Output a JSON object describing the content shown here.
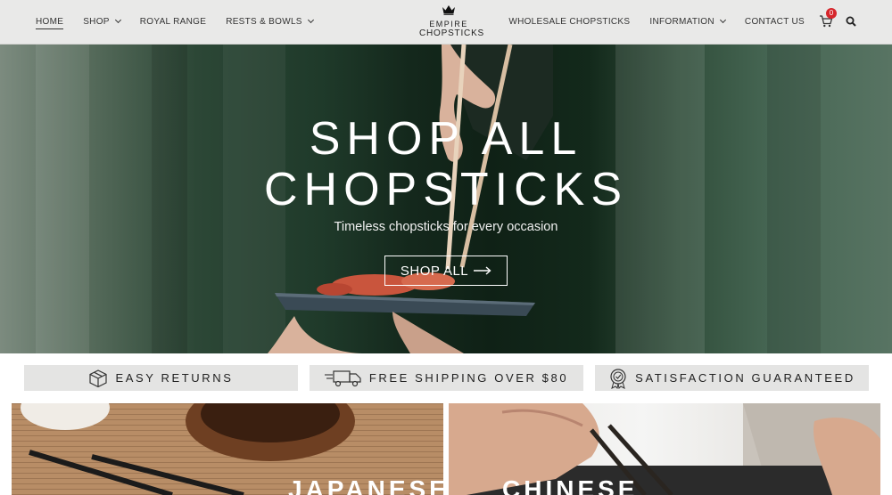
{
  "header": {
    "nav_left": [
      {
        "label": "HOME",
        "active": true,
        "dropdown": false
      },
      {
        "label": "SHOP",
        "active": false,
        "dropdown": true
      },
      {
        "label": "ROYAL RANGE",
        "active": false,
        "dropdown": false
      },
      {
        "label": "RESTS & BOWLS",
        "active": false,
        "dropdown": true
      }
    ],
    "logo": {
      "line1": "EMPIRE",
      "line2": "CHOPSTICKS",
      "icon": "crown-icon"
    },
    "nav_right": [
      {
        "label": "WHOLESALE CHOPSTICKS",
        "dropdown": false
      },
      {
        "label": "INFORMATION",
        "dropdown": true
      },
      {
        "label": "CONTACT US",
        "dropdown": false
      }
    ],
    "cart_count": "0",
    "cart_icon": "cart-icon",
    "search_icon": "search-icon",
    "badge_color": "#d6262b"
  },
  "hero": {
    "title_line1": "SHOP ALL",
    "title_line2": "CHOPSTICKS",
    "subtitle": "Timeless chopsticks for every occasion",
    "button_label": "SHOP ALL",
    "button_icon": "arrow-right-icon",
    "background_color": "#1f3a2a"
  },
  "features": [
    {
      "label": "EASY RETURNS",
      "icon": "box-icon"
    },
    {
      "label": "FREE SHIPPING OVER $80",
      "icon": "truck-icon"
    },
    {
      "label": "SATISFACTION GUARANTEED",
      "icon": "badge-icon"
    }
  ],
  "cards": [
    {
      "title": "JAPANESE"
    },
    {
      "title": "CHINESE"
    }
  ]
}
